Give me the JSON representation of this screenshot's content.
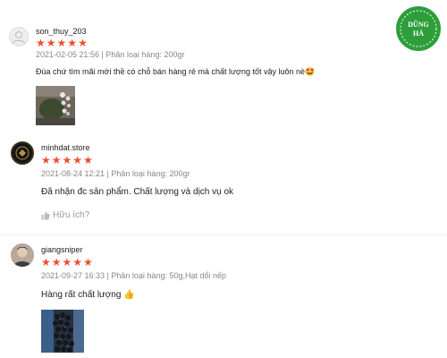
{
  "brand": {
    "logo_line1": "DŨNG",
    "logo_line2": "HÀ",
    "logo_color": "#2e9e3b"
  },
  "star_color": "#ee4d2d",
  "reviews": [
    {
      "username": "son_thuy_203",
      "rating": 5,
      "meta": "2021-02-05 21:56 | Phân loại hàng: 200gr",
      "comment": "Đùa chứ tìm mãi mới thề có chỗ bán hàng rẻ mà chất lượng tốt vậy luôn nè🤩",
      "avatar_icon": "default-user-icon",
      "has_photo": true
    },
    {
      "username": "minhdat.store",
      "rating": 5,
      "meta": "2021-08-24 12:21 | Phân loại hàng: 200gr",
      "comment": "Đã nhận đc sản phẩm. Chất lượng và dịch vụ ok",
      "helpful_label": "Hữu ích?",
      "avatar_icon": "store-logo-avatar"
    },
    {
      "username": "giangsniper",
      "rating": 5,
      "meta": "2021-09-27 16:33 | Phân loại hàng: 50g,Hạt dổi nếp",
      "comment": "Hàng rất chất lượng 👍",
      "avatar_icon": "user-photo-avatar",
      "has_photo": true
    }
  ]
}
